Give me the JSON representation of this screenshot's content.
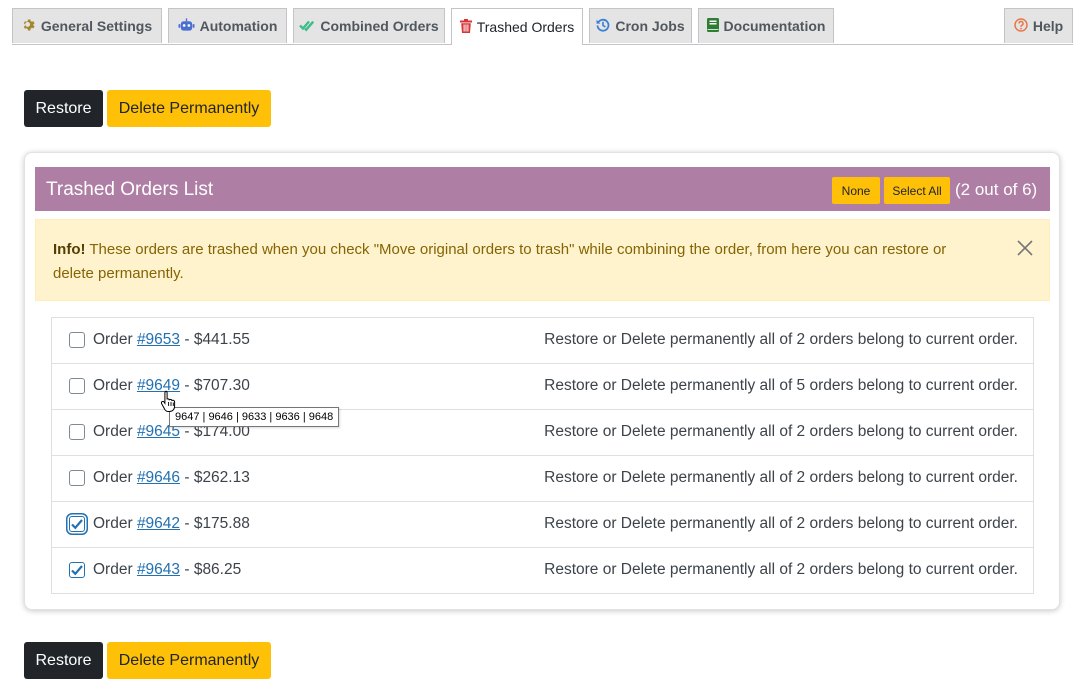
{
  "tabs": [
    {
      "label": "General Settings",
      "icon": "gear-icon",
      "active": false
    },
    {
      "label": "Automation",
      "icon": "robot-icon",
      "active": false
    },
    {
      "label": "Combined Orders",
      "icon": "double-check-icon",
      "active": false
    },
    {
      "label": "Trashed Orders",
      "icon": "trash-icon",
      "active": true
    },
    {
      "label": "Cron Jobs",
      "icon": "history-icon",
      "active": false
    },
    {
      "label": "Documentation",
      "icon": "book-icon",
      "active": false
    }
  ],
  "help_tab": {
    "label": "Help",
    "icon": "question-circle-icon"
  },
  "actions": {
    "restore_label": "Restore",
    "delete_label": "Delete Permanently"
  },
  "panel": {
    "title": "Trashed Orders List",
    "none_label": "None",
    "select_all_label": "Select All",
    "count_text": "(2 out of 6)"
  },
  "alert": {
    "strong": "Info!",
    "text": " These orders are trashed when you check \"Move original orders to trash\" while combining the order, from here you can restore or delete permanently."
  },
  "orders": [
    {
      "prefix": "Order ",
      "number": "#9653",
      "amount": " - $441.55",
      "checked": false,
      "description": "Restore or Delete permanently all of 2 orders belong to current order."
    },
    {
      "prefix": "Order ",
      "number": "#9649",
      "amount": " - $707.30",
      "checked": false,
      "description": "Restore or Delete permanently all of 5 orders belong to current order."
    },
    {
      "prefix": "Order ",
      "number": "#9645",
      "amount": " - $174.00",
      "checked": false,
      "description": "Restore or Delete permanently all of 2 orders belong to current order."
    },
    {
      "prefix": "Order ",
      "number": "#9646",
      "amount": " - $262.13",
      "checked": false,
      "description": "Restore or Delete permanently all of 2 orders belong to current order."
    },
    {
      "prefix": "Order ",
      "number": "#9642",
      "amount": " - $175.88",
      "checked": true,
      "description": "Restore or Delete permanently all of 2 orders belong to current order."
    },
    {
      "prefix": "Order ",
      "number": "#9643",
      "amount": " - $86.25",
      "checked": true,
      "description": "Restore or Delete permanently all of 2 orders belong to current order."
    }
  ],
  "tooltip": "9647 | 9646 | 9633 | 9636 | 9648",
  "colors": {
    "header_purple": "#ae7ea4",
    "warning_yellow": "#ffc107",
    "link_blue": "#2271b1",
    "dark_button": "#212529"
  }
}
